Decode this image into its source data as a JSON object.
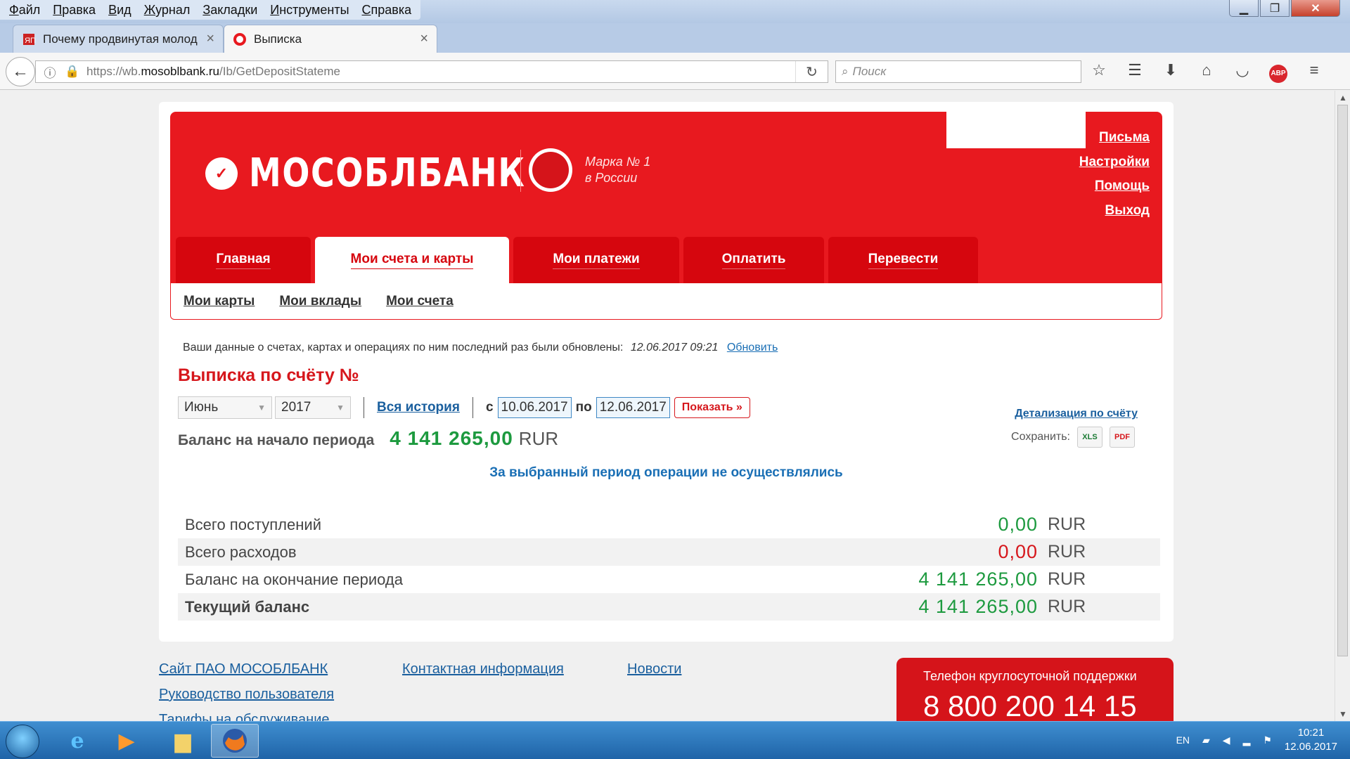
{
  "browser": {
    "menu": [
      "Файл",
      "Правка",
      "Вид",
      "Журнал",
      "Закладки",
      "Инструменты",
      "Справка"
    ],
    "window_controls": {
      "minimize": "▁",
      "maximize": "❐",
      "close": "✕"
    },
    "tabs": [
      {
        "title": "Почему продвинутая молод",
        "close": "×"
      },
      {
        "title": "Выписка",
        "close": "×"
      }
    ],
    "new_tab": "+",
    "url_prefix": "https://wb.",
    "url_domain": "mosoblbank.ru",
    "url_path": "/Ib/GetDepositStateme",
    "search_placeholder": "Поиск",
    "abp_label": "ABP"
  },
  "bank": {
    "logo_text": "МОСОБЛБАНК",
    "slogan_line1": "Марка № 1",
    "slogan_line2": "в России",
    "top_links": [
      "Письма",
      "Настройки",
      "Помощь",
      "Выход"
    ],
    "main_tabs": [
      "Главная",
      "Мои счета и карты",
      "Мои платежи",
      "Оплатить",
      "Перевести"
    ],
    "sub_nav": [
      "Мои карты",
      "Мои вклады",
      "Мои счета"
    ]
  },
  "statement": {
    "updated_text": "Ваши данные о счетах, картах и операциях по ним последний раз были обновлены:",
    "updated_time": "12.06.2017 09:21",
    "refresh_link": "Обновить",
    "title": "Выписка по счёту №",
    "month": "Июнь",
    "year": "2017",
    "all_history": "Вся история",
    "from_label": "с",
    "date_from": "10.06.2017",
    "to_label": "по",
    "date_to": "12.06.2017",
    "show_button": "Показать »",
    "detail_link": "Детализация по счёту",
    "save_label": "Сохранить:",
    "start_balance_label": "Баланс на начало периода",
    "start_balance_value": "4 141 265,00",
    "currency": "RUR",
    "no_operations": "За выбранный период операции не осуществлялись",
    "totals": [
      {
        "label": "Всего поступлений",
        "value": "0,00",
        "currency": "RUR"
      },
      {
        "label": "Всего расходов",
        "value": "0,00",
        "currency": "RUR"
      },
      {
        "label": "Баланс на окончание периода",
        "value": "4 141 265,00",
        "currency": "RUR"
      },
      {
        "label": "Текущий баланс",
        "value": "4 141 265,00",
        "currency": "RUR"
      }
    ]
  },
  "footer": {
    "col1": [
      "Сайт ПАО МОСОБЛБАНК",
      "Руководство пользователя",
      "Тарифы на обслуживание"
    ],
    "col2": [
      "Контактная информация"
    ],
    "col3": [
      "Новости"
    ],
    "support_title": "Телефон круглосуточной поддержки",
    "support_phone": "8 800 200 14 15"
  },
  "taskbar": {
    "lang": "EN",
    "time": "10:21",
    "date": "12.06.2017"
  },
  "colors": {
    "brand_red": "#e8191f",
    "balance_green": "#1d9a3f",
    "link_blue": "#1a5f9e"
  }
}
